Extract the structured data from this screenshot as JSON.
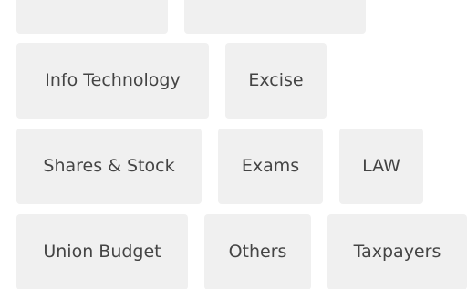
{
  "tags": {
    "info_technology": "Info Technology",
    "excise": "Excise",
    "shares_stock": "Shares & Stock",
    "exams": "Exams",
    "law": "LAW",
    "union_budget": "Union Budget",
    "others": "Others",
    "taxpayers": "Taxpayers"
  },
  "colors": {
    "tag_background": "#f0f0f0",
    "tag_text": "#444444",
    "page_background": "#ffffff"
  }
}
